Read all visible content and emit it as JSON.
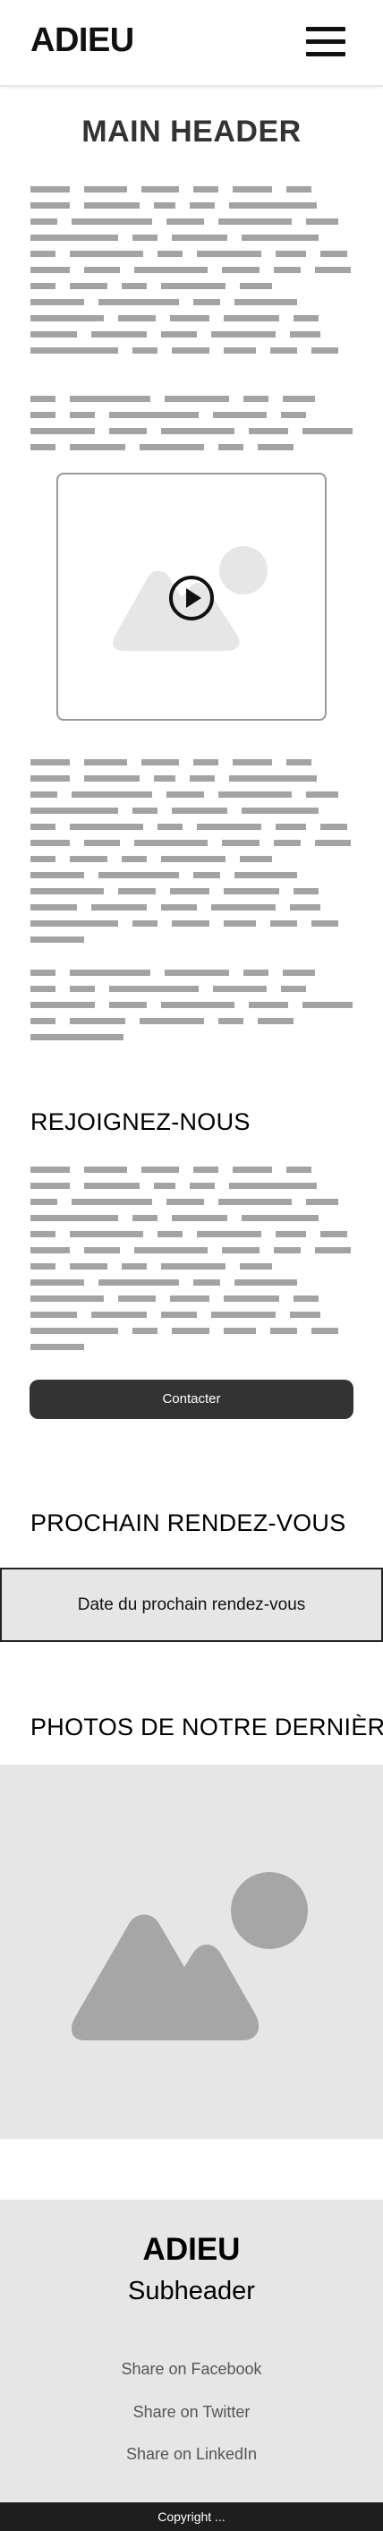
{
  "header": {
    "brand": "ADIEU",
    "menu_icon": "hamburger-menu-icon"
  },
  "main": {
    "title": "MAIN HEADER",
    "video_icons": [
      "image-placeholder-icon",
      "play-icon"
    ]
  },
  "join": {
    "title": "REJOIGNEZ-NOUS",
    "button_label": "Contacter"
  },
  "rendezvous": {
    "title": "PROCHAIN RENDEZ-VOUS",
    "date_text": "Date du prochain rendez-vous"
  },
  "photos": {
    "title": "PHOTOS DE NOTRE DERNIÈRE",
    "icon": "image-placeholder-icon"
  },
  "footer": {
    "brand": "ADIEU",
    "subheader": "Subheader",
    "share_links": [
      "Share on Facebook",
      "Share on Twitter",
      "Share on LinkedIn"
    ],
    "copyright": "Copyright ..."
  },
  "colors": {
    "accent_dark": "#333333",
    "placeholder_bg": "#e6e6e6",
    "placeholder_text_lines": "#a3a3a3",
    "copyright_bar": "#1e1e1e"
  }
}
